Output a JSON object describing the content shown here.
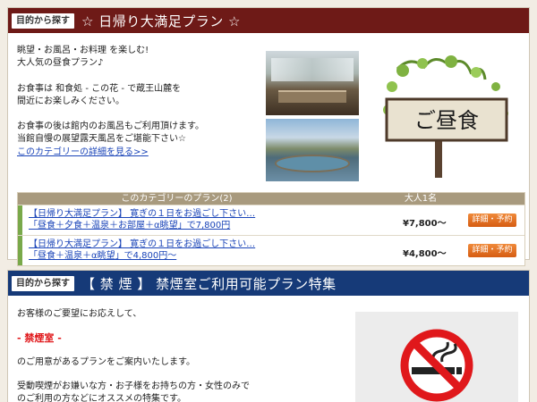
{
  "panel1": {
    "tag": "目的から探す",
    "title": "☆ 日帰り大満足プラン ☆",
    "intro": [
      "眺望・お風呂・お料理 を楽しむ!\n大人気の昼食プラン♪",
      "お食事は 和食処 - この花 - で蔵王山麓を\n間近にお楽しみください。",
      "お食事の後は館内のお風呂もご利用頂けます。\n当館自慢の展望露天風呂をご堪能下さい☆"
    ],
    "more_link": "このカテゴリーの詳細を見る>>",
    "sign_text": "ご昼食",
    "plan_header": {
      "name": "このカテゴリーのプラン(2)",
      "price": "大人1名"
    },
    "plans": [
      {
        "line1": "【日帰り大満足プラン】 寛ぎの１日をお過ごし下さい…",
        "line2": "「昼食＋夕食＋温泉＋お部屋＋α眺望」で7,800円",
        "price": "¥7,800〜",
        "button": "詳細・予約"
      },
      {
        "line1": "【日帰り大満足プラン】 寛ぎの１日をお過ごし下さい…",
        "line2": "「昼食＋温泉＋α眺望」で4,800円〜",
        "price": "¥4,800〜",
        "button": "詳細・予約"
      }
    ]
  },
  "panel2": {
    "tag": "目的から探す",
    "title": "【 禁 煙 】 禁煙室ご利用可能プラン特集",
    "line1": "お客様のご要望にお応えして、",
    "highlight": "- 禁煙室 -",
    "line2": "のご用意があるプランをご案内いたします。",
    "line3": "受動喫煙がお嫌いな方・お子様をお持ちの方・女性のみで",
    "line4": "のご利用の方などにオススメの特集です。"
  },
  "colors": {
    "header1": "#6e1a17",
    "header2": "#163a78",
    "accent_red": "#e0181b",
    "button_orange": "#e06f22"
  }
}
